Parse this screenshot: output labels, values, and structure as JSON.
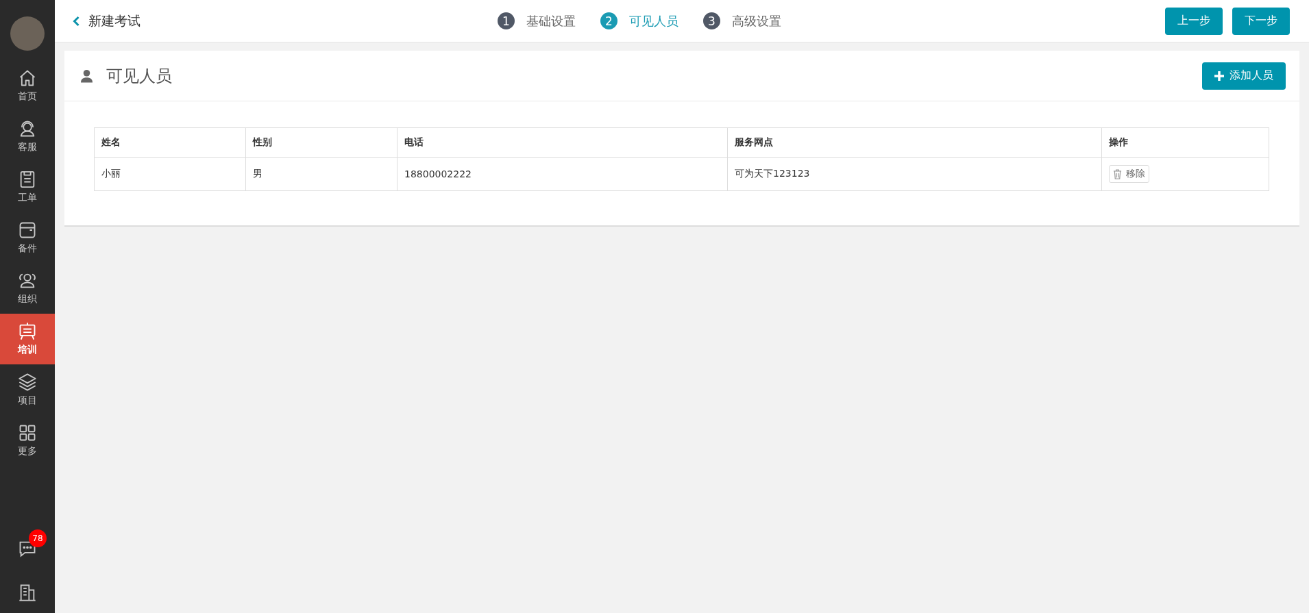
{
  "sidebar": {
    "items": [
      {
        "label": "首页",
        "selected": false
      },
      {
        "label": "客服",
        "selected": false
      },
      {
        "label": "工单",
        "selected": false
      },
      {
        "label": "备件",
        "selected": false
      },
      {
        "label": "组织",
        "selected": false
      },
      {
        "label": "培训",
        "selected": true
      },
      {
        "label": "项目",
        "selected": false
      },
      {
        "label": "更多",
        "selected": false
      }
    ],
    "message_badge": "78"
  },
  "topbar": {
    "title": "新建考试",
    "steps": [
      {
        "number": "1",
        "label": "基础设置",
        "selected": false
      },
      {
        "number": "2",
        "label": "可见人员",
        "selected": true
      },
      {
        "number": "3",
        "label": "高级设置",
        "selected": false
      }
    ],
    "buttons": [
      "上一步",
      "下一步"
    ]
  },
  "panel": {
    "title": "可见人员",
    "add_button": "添加人员",
    "table": {
      "columns": [
        "姓名",
        "性别",
        "电话",
        "服务网点",
        "操作"
      ],
      "rows": [
        {
          "cells": [
            "小丽",
            "男",
            "18800002222",
            "可为天下123123"
          ],
          "action": "移除"
        }
      ]
    }
  }
}
